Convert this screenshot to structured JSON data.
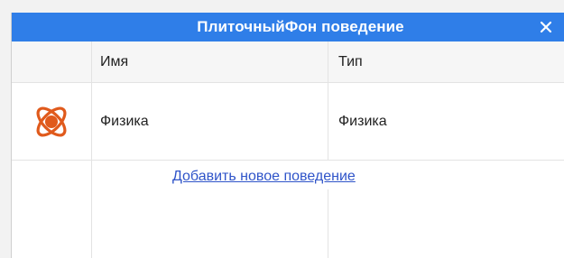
{
  "window": {
    "title": "ПлиточныйФон поведение",
    "close_symbol": "✕"
  },
  "table": {
    "columns": [
      "Имя",
      "Тип"
    ],
    "rows": [
      {
        "icon": "physics-atom-icon",
        "name": "Физика",
        "type": "Физика"
      }
    ]
  },
  "actions": {
    "add_behavior_link": "Добавить новое поведение"
  },
  "colors": {
    "titlebar": "#2f7ee8",
    "icon_accent": "#e05a1c",
    "link": "#2f54c9"
  }
}
